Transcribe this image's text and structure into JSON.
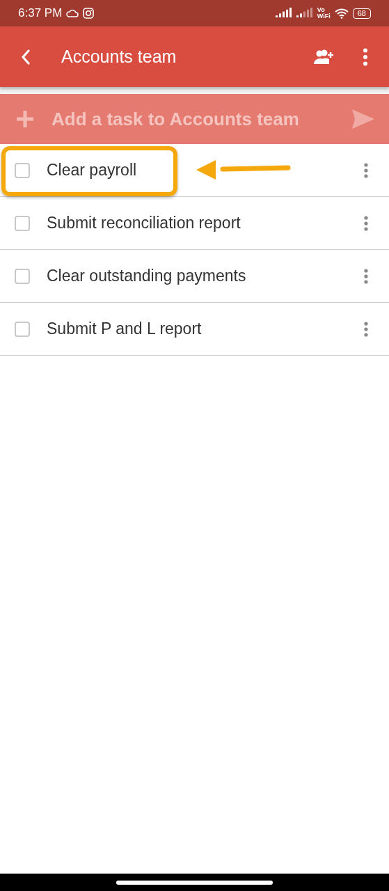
{
  "status_bar": {
    "time": "6:37 PM",
    "volte": [
      "Vo",
      "WiFi"
    ],
    "battery": "68"
  },
  "app_bar": {
    "title": "Accounts team"
  },
  "add_task": {
    "placeholder": "Add a task to Accounts team"
  },
  "tasks": [
    {
      "title": "Clear payroll",
      "checked": false,
      "highlighted": true
    },
    {
      "title": "Submit reconciliation report",
      "checked": false,
      "highlighted": false
    },
    {
      "title": "Clear outstanding payments",
      "checked": false,
      "highlighted": false
    },
    {
      "title": "Submit P and L report",
      "checked": false,
      "highlighted": false
    }
  ]
}
